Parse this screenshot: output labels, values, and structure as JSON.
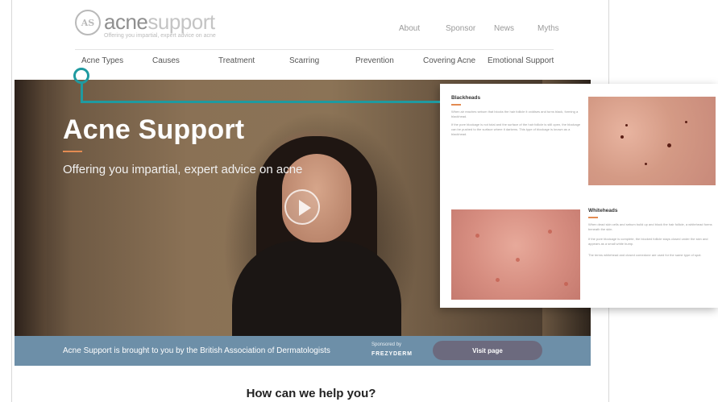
{
  "header": {
    "logo_text_a": "acne",
    "logo_text_b": "support",
    "logo_tagline": "Offering you impartial, expert advice on acne",
    "logo_mark": "AS",
    "top_links": [
      "About",
      "Sponsor",
      "News",
      "Myths"
    ]
  },
  "nav": {
    "items": [
      "Acne Types",
      "Causes",
      "Treatment",
      "Scarring",
      "Prevention",
      "Covering Acne",
      "Emotional Support"
    ]
  },
  "hero": {
    "title": "Acne Support",
    "subtitle": "Offering you impartial, expert advice on acne"
  },
  "sponsor_bar": {
    "text": "Acne Support is brought to you by the British Association of Dermatologists",
    "sponsored_by": "Sponsored by",
    "sponsor_name": "FREZYDERM",
    "visit_label": "Visit page"
  },
  "help": {
    "heading": "How can we help you?"
  },
  "detail_card": {
    "blackheads": {
      "heading": "Blackheads",
      "para1": "When air reaches sebum that blocks the hair follicle it oxidises and turns black, forming a blackhead.",
      "para2": "If the pore blockage is not total and the surface of the hair follicle is still open, the blockage can be pushed to the surface where it darkens. This type of blockage is known as a blackhead."
    },
    "whiteheads": {
      "heading": "Whiteheads",
      "para1": "When dead skin cells and sebum build up and block the hair follicle, a whitehead forms beneath the skin.",
      "para2": "If the pore blockage is complete, the blocked follicle stays closed under the skin and appears as a small white bump.",
      "para3": "The terms whitehead and closed comedone are used for the same type of spot."
    }
  },
  "colors": {
    "accent": "#e38b52",
    "connector": "#1f9aa0",
    "sponsor_bar": "#6d8fa8",
    "visit_button": "#6c6a7e"
  }
}
